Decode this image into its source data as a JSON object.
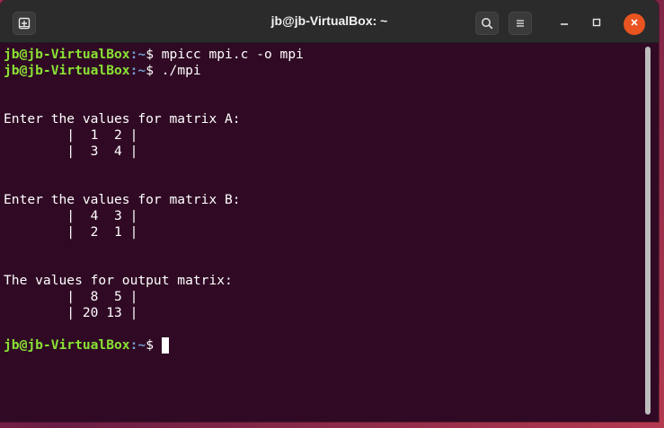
{
  "window": {
    "title": "jb@jb-VirtualBox: ~"
  },
  "icons": {
    "new_tab": "new-tab-icon",
    "search": "search-icon",
    "menu": "hamburger-menu-icon",
    "minimize": "minimize-icon",
    "maximize": "maximize-icon",
    "close": "close-icon"
  },
  "colors": {
    "terminal_bg": "#300a24",
    "prompt_user": "#8ae234",
    "prompt_path": "#729fcf",
    "close_button": "#e95420"
  },
  "terminal": {
    "prompt_user": "jb@jb-VirtualBox",
    "prompt_sep": ":",
    "prompt_path": "~",
    "prompt_symbol": "$ ",
    "lines": [
      {
        "type": "prompt",
        "command": "mpicc mpi.c -o mpi"
      },
      {
        "type": "prompt",
        "command": "./mpi"
      },
      {
        "type": "text",
        "text": ""
      },
      {
        "type": "text",
        "text": ""
      },
      {
        "type": "text",
        "text": "Enter the values for matrix A:"
      },
      {
        "type": "text",
        "text": "        |  1  2 |"
      },
      {
        "type": "text",
        "text": "        |  3  4 |"
      },
      {
        "type": "text",
        "text": ""
      },
      {
        "type": "text",
        "text": ""
      },
      {
        "type": "text",
        "text": "Enter the values for matrix B:"
      },
      {
        "type": "text",
        "text": "        |  4  3 |"
      },
      {
        "type": "text",
        "text": "        |  2  1 |"
      },
      {
        "type": "text",
        "text": ""
      },
      {
        "type": "text",
        "text": ""
      },
      {
        "type": "text",
        "text": "The values for output matrix:"
      },
      {
        "type": "text",
        "text": "        |  8  5 |"
      },
      {
        "type": "text",
        "text": "        | 20 13 |"
      },
      {
        "type": "text",
        "text": ""
      },
      {
        "type": "prompt",
        "command": "",
        "cursor": true
      }
    ]
  }
}
